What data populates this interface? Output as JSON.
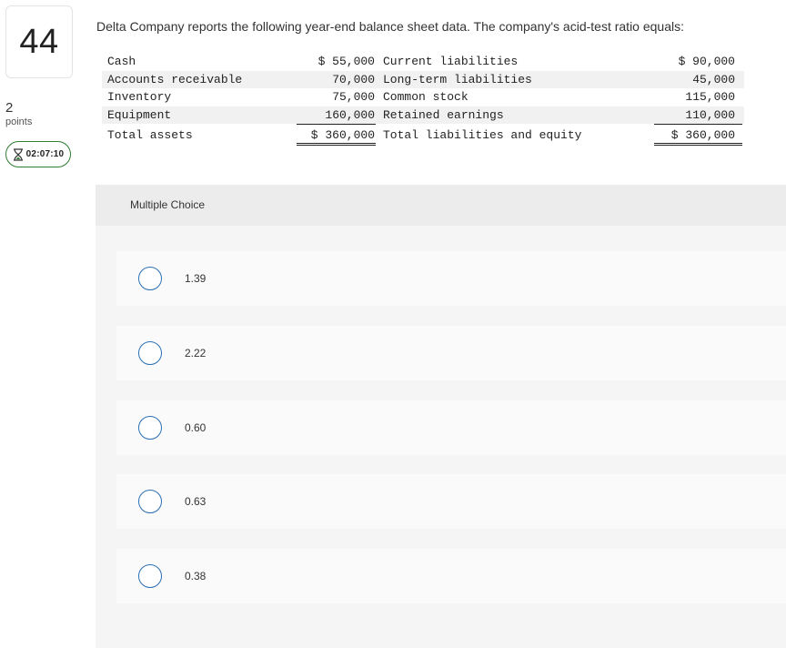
{
  "question_number": "44",
  "points": {
    "value": "2",
    "label": "points"
  },
  "timer": {
    "text": "02:07:10",
    "icon": "hourglass-icon"
  },
  "question_text": "Delta Company reports the following year-end balance sheet data. The company's acid-test ratio equals:",
  "balance_sheet": {
    "rows": [
      {
        "left_label": "Cash",
        "left_value": "$ 55,000",
        "right_label": "Current liabilities",
        "right_value": "$ 90,000"
      },
      {
        "left_label": "Accounts receivable",
        "left_value": "70,000",
        "right_label": "Long-term liabilities",
        "right_value": "45,000"
      },
      {
        "left_label": "Inventory",
        "left_value": "75,000",
        "right_label": "Common stock",
        "right_value": "115,000"
      },
      {
        "left_label": "Equipment",
        "left_value": "160,000",
        "right_label": "Retained earnings",
        "right_value": "110,000"
      }
    ],
    "total": {
      "left_label": "Total assets",
      "left_value": "$ 360,000",
      "right_label": "Total liabilities and equity",
      "right_value": "$ 360,000"
    }
  },
  "multiple_choice": {
    "title": "Multiple Choice",
    "options": [
      "1.39",
      "2.22",
      "0.60",
      "0.63",
      "0.38"
    ]
  },
  "colors": {
    "radio_border": "#2a6fb5",
    "timer_border": "#2e7d32",
    "panel_bg": "#f5f5f5"
  }
}
